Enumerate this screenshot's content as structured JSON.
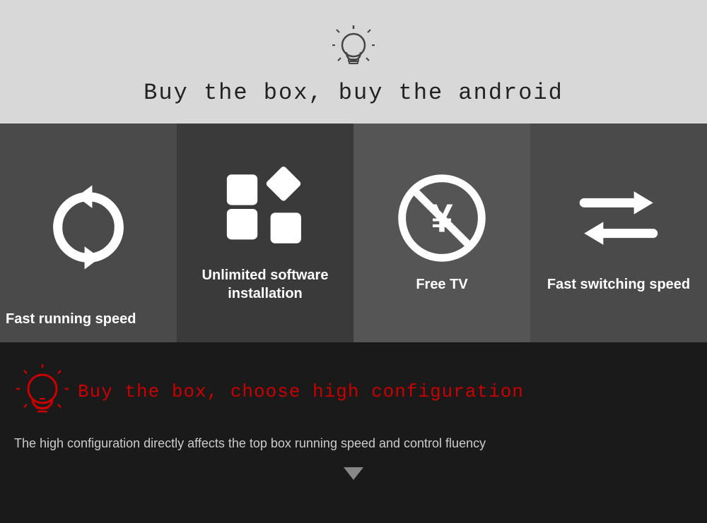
{
  "top": {
    "tagline": "Buy the box, buy the android"
  },
  "features": [
    {
      "id": "fast-running",
      "label": "Fast running speed",
      "icon": "sync"
    },
    {
      "id": "unlimited-software",
      "label": "Unlimited software installation",
      "icon": "apps"
    },
    {
      "id": "free-tv",
      "label": "Free TV",
      "icon": "no-yen"
    },
    {
      "id": "fast-switching",
      "label": "Fast switching speed",
      "icon": "switch"
    }
  ],
  "bottom": {
    "tagline": "Buy the box, choose high configuration",
    "description": "The high configuration directly affects the top box running speed and control fluency"
  }
}
